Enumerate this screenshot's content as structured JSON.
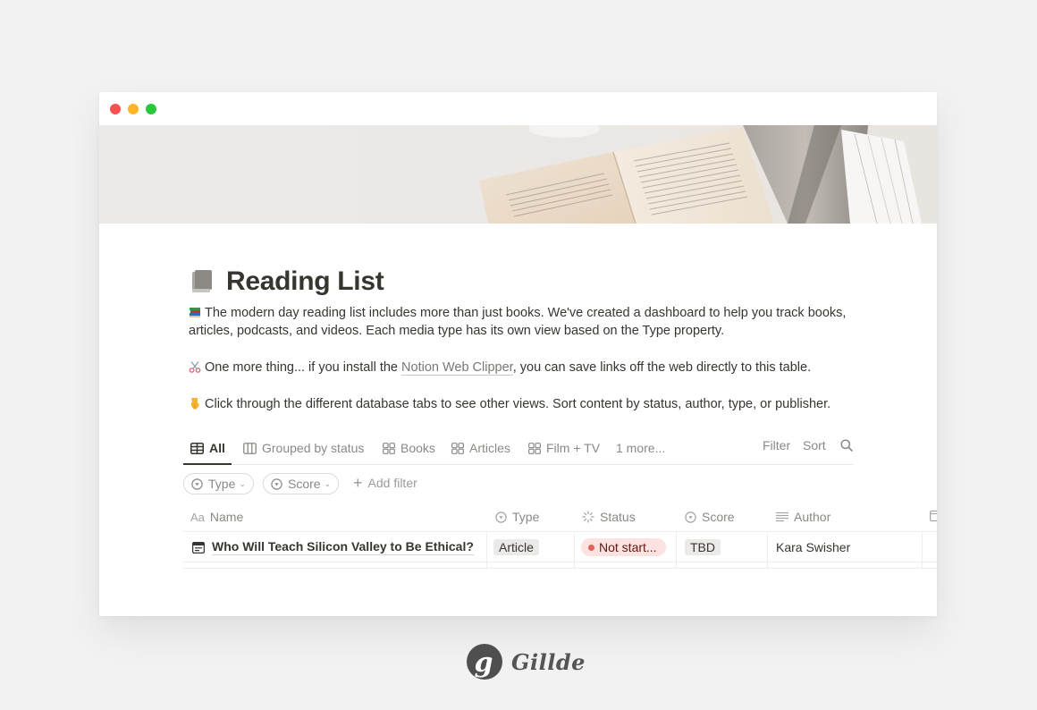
{
  "window": {
    "traffic_lights": {
      "close": "#fc4f4f",
      "minimize": "#fdb52a",
      "maximize": "#2ac63e"
    }
  },
  "cover": {
    "description": "Open vintage books on white fabric"
  },
  "page": {
    "icon": "book-icon",
    "title": "Reading List",
    "paragraphs": [
      {
        "emoji": "books-emoji",
        "text": "The modern day reading list includes more than just books. We've created a dashboard to help you track books, articles, podcasts, and videos. Each media type has its own view based on the Type property."
      },
      {
        "emoji": "scissors-emoji",
        "text_before": "One more thing... if you install the ",
        "link": "Notion Web Clipper",
        "text_after": ", you can save links off the web directly to this table."
      },
      {
        "emoji": "pointing-down-emoji",
        "text": "Click through the different database tabs to see other views. Sort content by status, author, type, or publisher."
      }
    ]
  },
  "views": {
    "tabs": [
      {
        "label": "All",
        "icon": "table-icon",
        "active": true
      },
      {
        "label": "Grouped by status",
        "icon": "board-icon",
        "active": false
      },
      {
        "label": "Books",
        "icon": "gallery-icon",
        "active": false
      },
      {
        "label": "Articles",
        "icon": "gallery-icon",
        "active": false
      },
      {
        "label": "Film + TV",
        "icon": "gallery-icon",
        "active": false
      },
      {
        "label": "1 more...",
        "icon": "",
        "active": false
      }
    ],
    "actions": {
      "filter": "Filter",
      "sort": "Sort",
      "search_icon": "search-icon"
    }
  },
  "filters": {
    "chips": [
      {
        "label": "Type",
        "icon": "select-icon"
      },
      {
        "label": "Score",
        "icon": "select-icon"
      }
    ],
    "add_filter": "Add filter"
  },
  "table": {
    "columns": [
      {
        "label": "Name",
        "icon": "title-icon",
        "icon_text": "Aa"
      },
      {
        "label": "Type",
        "icon": "select-icon"
      },
      {
        "label": "Status",
        "icon": "status-icon"
      },
      {
        "label": "Score",
        "icon": "select-icon"
      },
      {
        "label": "Author",
        "icon": "text-icon"
      },
      {
        "label": "",
        "icon": "date-icon"
      }
    ],
    "rows": [
      {
        "name": "Who Will Teach Silicon Valley to Be Ethical?",
        "type": "Article",
        "status": "Not start...",
        "status_color": "#e16259",
        "score": "TBD",
        "author": "Kara Swisher"
      }
    ]
  },
  "brand": {
    "logo_letter": "g",
    "name": "Gillde"
  }
}
